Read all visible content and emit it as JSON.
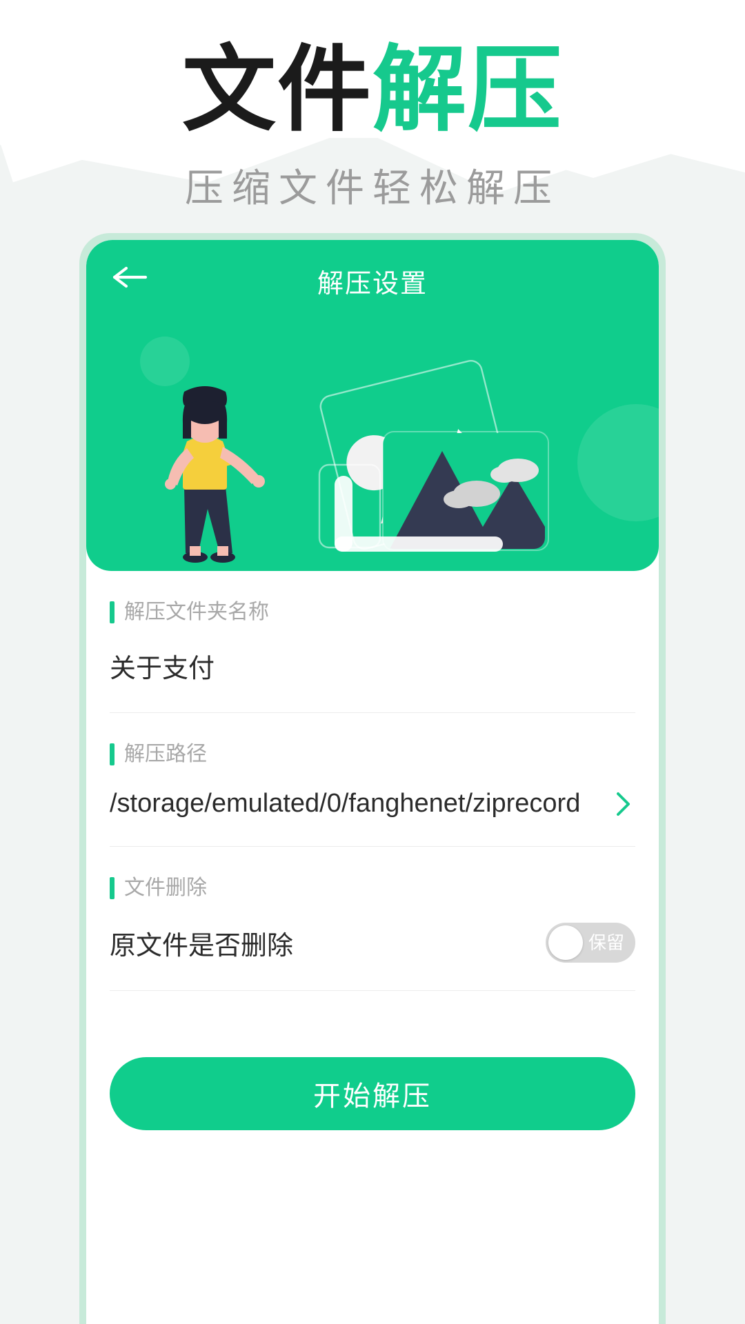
{
  "promo": {
    "title_dark": "文件",
    "title_accent": "解压",
    "subtitle": "压缩文件轻松解压"
  },
  "colors": {
    "brand_green": "#10cd8c",
    "accent_green": "#16c98d",
    "frame_green": "#c7ead9",
    "label_grey": "#a8a8a8",
    "value_dark": "#2b2b2b",
    "toggle_off": "#d8d8d8",
    "illus_dark": "#343a52",
    "illus_yellow": "#f5cf3c",
    "illus_skin": "#f6bdb2"
  },
  "app": {
    "nav": {
      "back_icon": "arrow-left-icon",
      "title": "解压设置"
    },
    "illustration": {
      "name": "unzip-illustration",
      "alt": "女孩与图片文件夹插画"
    },
    "fields": [
      {
        "label": "解压文件夹名称",
        "value": "关于支付",
        "type": "text",
        "name": "folder-name"
      },
      {
        "label": "解压路径",
        "value": "/storage/emulated/0/fanghenet/ziprecord",
        "type": "path",
        "name": "extract-path",
        "chevron_icon": "chevron-right-icon"
      },
      {
        "label": "文件删除",
        "value": "原文件是否删除",
        "type": "toggle",
        "name": "delete-original",
        "toggle_state": "off",
        "toggle_label": "保留"
      }
    ],
    "cta": {
      "label": "开始解压"
    }
  }
}
